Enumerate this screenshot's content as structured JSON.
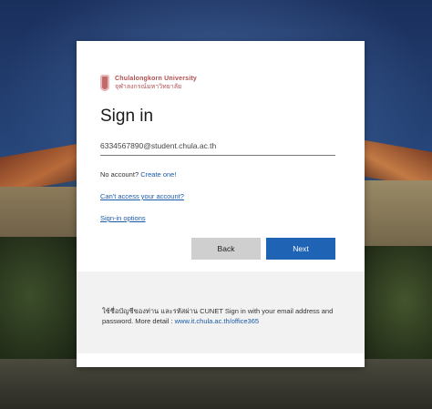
{
  "logo": {
    "name_en": "Chulalongkorn University",
    "name_th": "จุฬาลงกรณ์มหาวิทยาลัย"
  },
  "signin": {
    "title": "Sign in",
    "email_value": "6334567890@student.chula.ac.th",
    "no_account_text": "No account?",
    "create_one": "Create one!",
    "cant_access": "Can't access your account?",
    "signin_options": "Sign-in options"
  },
  "buttons": {
    "back": "Back",
    "next": "Next"
  },
  "info": {
    "message": "ใช้ชื่อบัญชีของท่าน และรหัสผ่าน CUNET Sign in with your email address and password. More detail :",
    "link": "www.it.chula.ac.th/office365"
  },
  "colors": {
    "brand": "#b04e4e",
    "accent": "#1f63b5",
    "link": "#1a5aa8"
  }
}
